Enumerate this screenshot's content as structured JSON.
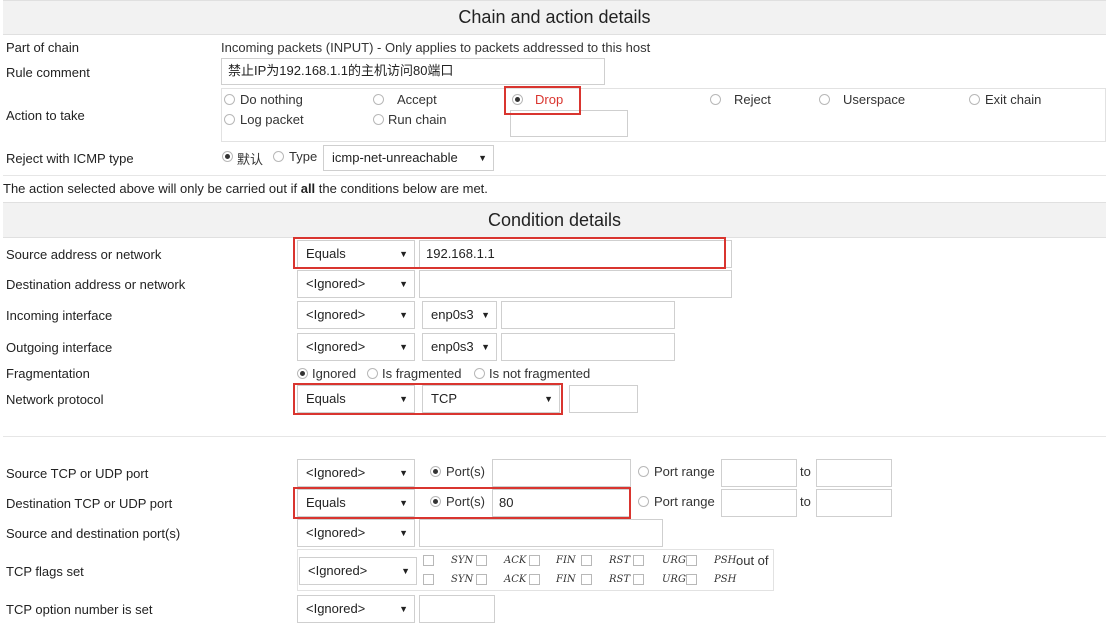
{
  "chain_section": {
    "title": "Chain and action details",
    "part_of_chain": {
      "label": "Part of chain",
      "value": "Incoming packets (INPUT) - Only applies to packets addressed to this host"
    },
    "rule_comment": {
      "label": "Rule comment",
      "value": "禁止IP为192.168.1.1的主机访问80端口"
    },
    "action": {
      "label": "Action to take",
      "options": [
        "Do nothing",
        "Accept",
        "Drop",
        "Reject",
        "Userspace",
        "Exit chain",
        "Log packet",
        "Run chain"
      ],
      "selected": "Drop"
    },
    "reject_icmp": {
      "label": "Reject with ICMP type",
      "default_label": "默认",
      "type_label": "Type",
      "type_value": "icmp-net-unreachable"
    }
  },
  "note": {
    "before": "The action selected above will only be carried out if ",
    "bold": "all",
    "after": " the conditions below are met."
  },
  "condition_section": {
    "title": "Condition details",
    "source_address": {
      "label": "Source address or network",
      "mode": "Equals",
      "value": "192.168.1.1"
    },
    "dest_address": {
      "label": "Destination address or network",
      "mode": "<Ignored>",
      "value": ""
    },
    "in_iface": {
      "label": "Incoming interface",
      "mode": "<Ignored>",
      "iface": "enp0s3"
    },
    "out_iface": {
      "label": "Outgoing interface",
      "mode": "<Ignored>",
      "iface": "enp0s3"
    },
    "fragmentation": {
      "label": "Fragmentation",
      "options": [
        "Ignored",
        "Is fragmented",
        "Is not fragmented"
      ],
      "selected": "Ignored"
    },
    "protocol": {
      "label": "Network protocol",
      "mode": "Equals",
      "value": "TCP"
    },
    "src_port": {
      "label": "Source TCP or UDP port",
      "mode": "<Ignored>",
      "ports_label": "Port(s)",
      "range_label": "Port range",
      "to_label": "to",
      "value": ""
    },
    "dst_port": {
      "label": "Destination TCP or UDP port",
      "mode": "Equals",
      "ports_label": "Port(s)",
      "range_label": "Port range",
      "to_label": "to",
      "value": "80"
    },
    "src_dst_ports": {
      "label": "Source and destination port(s)",
      "mode": "<Ignored>"
    },
    "tcp_flags": {
      "label": "TCP flags set",
      "mode": "<Ignored>",
      "flags": [
        "SYN",
        "ACK",
        "FIN",
        "RST",
        "URG",
        "PSH"
      ],
      "out_of_label": "out of"
    },
    "tcp_option": {
      "label": "TCP option number is set",
      "mode": "<Ignored>"
    }
  },
  "highlight_color": "#d9352f"
}
